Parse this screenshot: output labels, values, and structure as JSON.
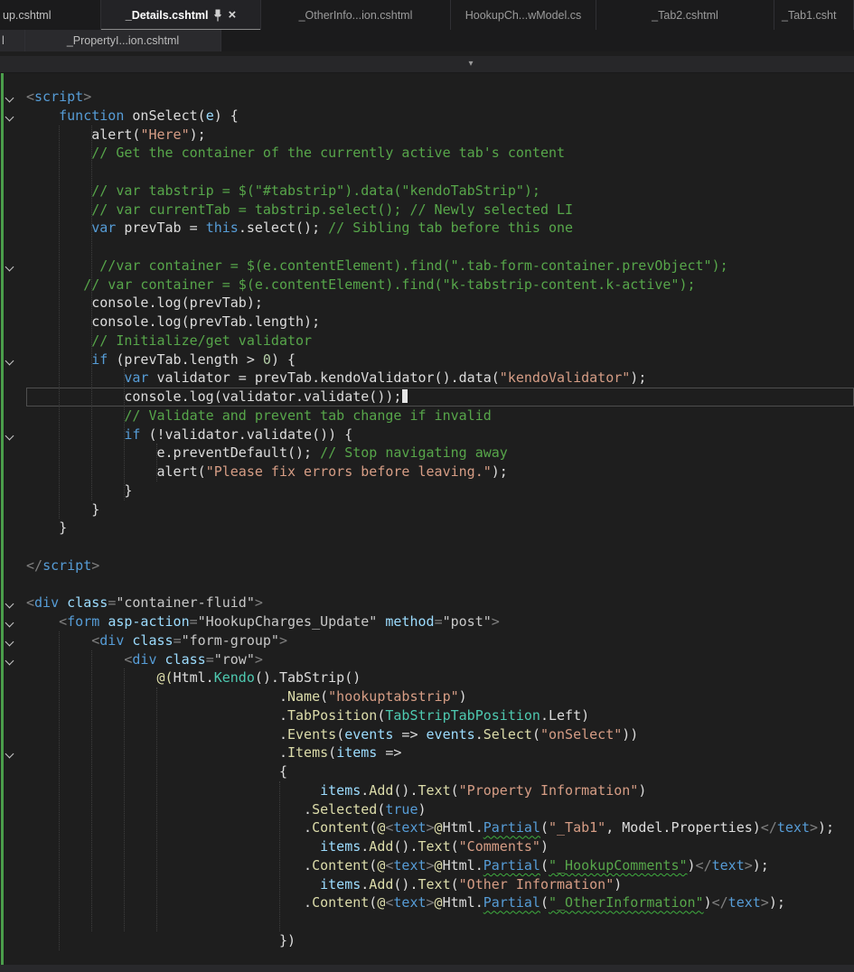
{
  "icons": {
    "close": "×",
    "dropdown_chevron": "▾",
    "pin": "pin-icon"
  },
  "colors": {
    "background": "#1e1e1e",
    "tab_bar": "#1b1b1c",
    "active_tab_text": "#ffffff",
    "inactive_tab_text": "#9b9b9b",
    "keyword": "#569cd6",
    "string": "#d69d85",
    "comment": "#57a64a",
    "method": "#dcdcaa",
    "type": "#4ec9b0",
    "parameter": "#9cdcfe",
    "change_tracking": "#4b9e4b"
  },
  "tab_rows": {
    "row1": [
      {
        "label": "up.cshtml"
      },
      {
        "label": "_Details.cshtml",
        "active": true,
        "pinned": true
      },
      {
        "label": "_OtherInfo...ion.cshtml"
      },
      {
        "label": "HookupCh...wModel.cs"
      },
      {
        "label": "_Tab2.cshtml"
      },
      {
        "label": "_Tab1.csht"
      }
    ],
    "row2": [
      {
        "label": "l"
      },
      {
        "label": "_PropertyI...ion.cshtml"
      }
    ]
  },
  "editor": {
    "caret_line": 17,
    "code_lines": [
      {
        "fold": true,
        "indent": 0,
        "segments": [
          {
            "c": "delim",
            "t": "<"
          },
          {
            "c": "tag",
            "t": "script"
          },
          {
            "c": "delim",
            "t": ">"
          }
        ]
      },
      {
        "fold": true,
        "indent": 4,
        "segments": [
          {
            "c": "kw",
            "t": "function"
          },
          {
            "c": "pl",
            "t": " onSelect("
          },
          {
            "c": "param",
            "t": "e"
          },
          {
            "c": "pl",
            "t": ") {"
          }
        ]
      },
      {
        "indent": 8,
        "segments": [
          {
            "c": "pl",
            "t": "alert("
          },
          {
            "c": "str",
            "t": "\"Here\""
          },
          {
            "c": "pl",
            "t": ");"
          }
        ]
      },
      {
        "indent": 8,
        "segments": [
          {
            "c": "com",
            "t": "// Get the container of the currently active tab's content"
          }
        ]
      },
      {
        "indent": 0,
        "segments": []
      },
      {
        "indent": 8,
        "segments": [
          {
            "c": "com",
            "t": "// var tabstrip = $(\"#tabstrip\").data(\"kendoTabStrip\");"
          }
        ]
      },
      {
        "indent": 8,
        "segments": [
          {
            "c": "com",
            "t": "// var currentTab = tabstrip.select(); // Newly selected LI"
          }
        ]
      },
      {
        "indent": 8,
        "segments": [
          {
            "c": "kw",
            "t": "var"
          },
          {
            "c": "pl",
            "t": " prevTab = "
          },
          {
            "c": "kw",
            "t": "this"
          },
          {
            "c": "pl",
            "t": ".select(); "
          },
          {
            "c": "com",
            "t": "// Sibling tab before this one"
          }
        ]
      },
      {
        "indent": 0,
        "segments": []
      },
      {
        "fold": true,
        "indent": 9,
        "segments": [
          {
            "c": "com",
            "t": "//var container = $(e.contentElement).find(\".tab-form-container.prevObject\");"
          }
        ]
      },
      {
        "indent": 7,
        "segments": [
          {
            "c": "com",
            "t": "// var container = $(e.contentElement).find(\"k-tabstrip-content.k-active\");"
          }
        ]
      },
      {
        "indent": 8,
        "segments": [
          {
            "c": "pl",
            "t": "console.log(prevTab);"
          }
        ]
      },
      {
        "indent": 8,
        "segments": [
          {
            "c": "pl",
            "t": "console.log(prevTab.length);"
          }
        ]
      },
      {
        "indent": 8,
        "segments": [
          {
            "c": "com",
            "t": "// Initialize/get validator"
          }
        ]
      },
      {
        "fold": true,
        "indent": 8,
        "segments": [
          {
            "c": "kw",
            "t": "if"
          },
          {
            "c": "pl",
            "t": " (prevTab.length > "
          },
          {
            "c": "num",
            "t": "0"
          },
          {
            "c": "pl",
            "t": ") {"
          }
        ]
      },
      {
        "indent": 12,
        "segments": [
          {
            "c": "kw",
            "t": "var"
          },
          {
            "c": "pl",
            "t": " validator = prevTab.kendoValidator().data("
          },
          {
            "c": "str",
            "t": "\"kendoValidator\""
          },
          {
            "c": "pl",
            "t": ");"
          }
        ]
      },
      {
        "indent": 12,
        "segments": [
          {
            "c": "pl",
            "t": "console.log(validator.validate());"
          }
        ]
      },
      {
        "indent": 12,
        "segments": [
          {
            "c": "com",
            "t": "// Validate and prevent tab change if invalid"
          }
        ]
      },
      {
        "fold": true,
        "indent": 12,
        "segments": [
          {
            "c": "kw",
            "t": "if"
          },
          {
            "c": "pl",
            "t": " (!validator.validate()) {"
          }
        ]
      },
      {
        "indent": 16,
        "segments": [
          {
            "c": "pl",
            "t": "e.preventDefault(); "
          },
          {
            "c": "com",
            "t": "// Stop navigating away"
          }
        ]
      },
      {
        "indent": 16,
        "segments": [
          {
            "c": "pl",
            "t": "alert("
          },
          {
            "c": "str",
            "t": "\"Please fix errors before leaving.\""
          },
          {
            "c": "pl",
            "t": ");"
          }
        ]
      },
      {
        "indent": 12,
        "segments": [
          {
            "c": "pl",
            "t": "}"
          }
        ]
      },
      {
        "indent": 8,
        "segments": [
          {
            "c": "pl",
            "t": "}"
          }
        ]
      },
      {
        "indent": 4,
        "segments": [
          {
            "c": "pl",
            "t": "}"
          }
        ]
      },
      {
        "indent": 0,
        "segments": []
      },
      {
        "indent": 0,
        "segments": [
          {
            "c": "delim",
            "t": "</"
          },
          {
            "c": "tag",
            "t": "script"
          },
          {
            "c": "delim",
            "t": ">"
          }
        ]
      },
      {
        "indent": 0,
        "segments": []
      },
      {
        "fold": true,
        "indent": 0,
        "segments": [
          {
            "c": "delim",
            "t": "<"
          },
          {
            "c": "tag",
            "t": "div"
          },
          {
            "c": "pl",
            "t": " "
          },
          {
            "c": "attr",
            "t": "class"
          },
          {
            "c": "delim",
            "t": "="
          },
          {
            "c": "val",
            "t": "\"container-fluid\""
          },
          {
            "c": "delim",
            "t": ">"
          }
        ]
      },
      {
        "fold": true,
        "indent": 4,
        "segments": [
          {
            "c": "delim",
            "t": "<"
          },
          {
            "c": "tag",
            "t": "form"
          },
          {
            "c": "pl",
            "t": " "
          },
          {
            "c": "attr",
            "t": "asp-action"
          },
          {
            "c": "delim",
            "t": "="
          },
          {
            "c": "val",
            "t": "\"HookupCharges_Update\""
          },
          {
            "c": "pl",
            "t": " "
          },
          {
            "c": "attr",
            "t": "method"
          },
          {
            "c": "delim",
            "t": "="
          },
          {
            "c": "val",
            "t": "\"post\""
          },
          {
            "c": "delim",
            "t": ">"
          }
        ]
      },
      {
        "fold": true,
        "indent": 8,
        "segments": [
          {
            "c": "delim",
            "t": "<"
          },
          {
            "c": "tag",
            "t": "div"
          },
          {
            "c": "pl",
            "t": " "
          },
          {
            "c": "attr",
            "t": "class"
          },
          {
            "c": "delim",
            "t": "="
          },
          {
            "c": "val",
            "t": "\"form-group\""
          },
          {
            "c": "delim",
            "t": ">"
          }
        ]
      },
      {
        "fold": true,
        "indent": 12,
        "segments": [
          {
            "c": "delim",
            "t": "<"
          },
          {
            "c": "tag",
            "t": "div"
          },
          {
            "c": "pl",
            "t": " "
          },
          {
            "c": "attr",
            "t": "class"
          },
          {
            "c": "delim",
            "t": "="
          },
          {
            "c": "val",
            "t": "\"row\""
          },
          {
            "c": "delim",
            "t": ">"
          }
        ]
      },
      {
        "indent": 16,
        "segments": [
          {
            "c": "razor",
            "t": "@("
          },
          {
            "c": "pl",
            "t": "Html."
          },
          {
            "c": "type",
            "t": "Kendo"
          },
          {
            "c": "pl",
            "t": "().TabStrip()"
          }
        ]
      },
      {
        "indent": 31,
        "segments": [
          {
            "c": "pl",
            "t": "."
          },
          {
            "c": "meth",
            "t": "Name"
          },
          {
            "c": "pl",
            "t": "("
          },
          {
            "c": "str",
            "t": "\"hookuptabstrip\""
          },
          {
            "c": "pl",
            "t": ")"
          }
        ]
      },
      {
        "indent": 31,
        "segments": [
          {
            "c": "pl",
            "t": "."
          },
          {
            "c": "meth",
            "t": "TabPosition"
          },
          {
            "c": "pl",
            "t": "("
          },
          {
            "c": "type",
            "t": "TabStripTabPosition"
          },
          {
            "c": "pl",
            "t": ".Left)"
          }
        ]
      },
      {
        "indent": 31,
        "segments": [
          {
            "c": "pl",
            "t": "."
          },
          {
            "c": "meth",
            "t": "Events"
          },
          {
            "c": "pl",
            "t": "("
          },
          {
            "c": "param",
            "t": "events"
          },
          {
            "c": "pl",
            "t": " => "
          },
          {
            "c": "param",
            "t": "events"
          },
          {
            "c": "pl",
            "t": "."
          },
          {
            "c": "meth",
            "t": "Select"
          },
          {
            "c": "pl",
            "t": "("
          },
          {
            "c": "str",
            "t": "\"onSelect\""
          },
          {
            "c": "pl",
            "t": "))"
          }
        ]
      },
      {
        "fold": true,
        "indent": 31,
        "segments": [
          {
            "c": "pl",
            "t": "."
          },
          {
            "c": "meth",
            "t": "Items"
          },
          {
            "c": "pl",
            "t": "("
          },
          {
            "c": "param",
            "t": "items"
          },
          {
            "c": "pl",
            "t": " =>"
          }
        ]
      },
      {
        "indent": 31,
        "segments": [
          {
            "c": "pl",
            "t": "{"
          }
        ]
      },
      {
        "indent": 36,
        "segments": [
          {
            "c": "param",
            "t": "items"
          },
          {
            "c": "pl",
            "t": "."
          },
          {
            "c": "meth",
            "t": "Add"
          },
          {
            "c": "pl",
            "t": "()."
          },
          {
            "c": "meth",
            "t": "Text"
          },
          {
            "c": "pl",
            "t": "("
          },
          {
            "c": "str",
            "t": "\"Property Information\""
          },
          {
            "c": "pl",
            "t": ")"
          }
        ]
      },
      {
        "indent": 34,
        "segments": [
          {
            "c": "pl",
            "t": "."
          },
          {
            "c": "meth",
            "t": "Selected"
          },
          {
            "c": "pl",
            "t": "("
          },
          {
            "c": "kw",
            "t": "true"
          },
          {
            "c": "pl",
            "t": ")"
          }
        ]
      },
      {
        "indent": 34,
        "segments": [
          {
            "c": "pl",
            "t": "."
          },
          {
            "c": "meth",
            "t": "Content"
          },
          {
            "c": "pl",
            "t": "("
          },
          {
            "c": "razor",
            "t": "@"
          },
          {
            "c": "delim",
            "t": "<"
          },
          {
            "c": "tag",
            "t": "text"
          },
          {
            "c": "delim",
            "t": ">"
          },
          {
            "c": "razor",
            "t": "@"
          },
          {
            "c": "pl",
            "t": "Html."
          },
          {
            "c": "dep",
            "t": "Partial"
          },
          {
            "c": "pl",
            "t": "("
          },
          {
            "c": "str",
            "t": "\"_Tab1\""
          },
          {
            "c": "pl",
            "t": ", Model.Properties)"
          },
          {
            "c": "delim",
            "t": "</"
          },
          {
            "c": "tag",
            "t": "text"
          },
          {
            "c": "delim",
            "t": ">"
          },
          {
            "c": "pl",
            "t": ");"
          }
        ]
      },
      {
        "indent": 36,
        "segments": [
          {
            "c": "param",
            "t": "items"
          },
          {
            "c": "pl",
            "t": "."
          },
          {
            "c": "meth",
            "t": "Add"
          },
          {
            "c": "pl",
            "t": "()."
          },
          {
            "c": "meth",
            "t": "Text"
          },
          {
            "c": "pl",
            "t": "("
          },
          {
            "c": "str",
            "t": "\"Comments\""
          },
          {
            "c": "pl",
            "t": ")"
          }
        ]
      },
      {
        "indent": 34,
        "segments": [
          {
            "c": "pl",
            "t": "."
          },
          {
            "c": "meth",
            "t": "Content"
          },
          {
            "c": "pl",
            "t": "("
          },
          {
            "c": "razor",
            "t": "@"
          },
          {
            "c": "delim",
            "t": "<"
          },
          {
            "c": "tag",
            "t": "text"
          },
          {
            "c": "delim",
            "t": ">"
          },
          {
            "c": "razor",
            "t": "@"
          },
          {
            "c": "pl",
            "t": "Html."
          },
          {
            "c": "dep",
            "t": "Partial"
          },
          {
            "c": "pl",
            "t": "("
          },
          {
            "c": "depg",
            "t": "\"_HookupComments\""
          },
          {
            "c": "pl",
            "t": ")"
          },
          {
            "c": "delim",
            "t": "</"
          },
          {
            "c": "tag",
            "t": "text"
          },
          {
            "c": "delim",
            "t": ">"
          },
          {
            "c": "pl",
            "t": ");"
          }
        ]
      },
      {
        "indent": 36,
        "segments": [
          {
            "c": "param",
            "t": "items"
          },
          {
            "c": "pl",
            "t": "."
          },
          {
            "c": "meth",
            "t": "Add"
          },
          {
            "c": "pl",
            "t": "()."
          },
          {
            "c": "meth",
            "t": "Text"
          },
          {
            "c": "pl",
            "t": "("
          },
          {
            "c": "str",
            "t": "\"Other Information\""
          },
          {
            "c": "pl",
            "t": ")"
          }
        ]
      },
      {
        "indent": 34,
        "segments": [
          {
            "c": "pl",
            "t": "."
          },
          {
            "c": "meth",
            "t": "Content"
          },
          {
            "c": "pl",
            "t": "("
          },
          {
            "c": "razor",
            "t": "@"
          },
          {
            "c": "delim",
            "t": "<"
          },
          {
            "c": "tag",
            "t": "text"
          },
          {
            "c": "delim",
            "t": ">"
          },
          {
            "c": "razor",
            "t": "@"
          },
          {
            "c": "pl",
            "t": "Html."
          },
          {
            "c": "dep",
            "t": "Partial"
          },
          {
            "c": "pl",
            "t": "("
          },
          {
            "c": "depg",
            "t": "\"_OtherInformation\""
          },
          {
            "c": "pl",
            "t": ")"
          },
          {
            "c": "delim",
            "t": "</"
          },
          {
            "c": "tag",
            "t": "text"
          },
          {
            "c": "delim",
            "t": ">"
          },
          {
            "c": "pl",
            "t": ");"
          }
        ]
      },
      {
        "indent": 0,
        "segments": []
      },
      {
        "indent": 31,
        "segments": [
          {
            "c": "pl",
            "t": "})"
          }
        ]
      }
    ]
  }
}
